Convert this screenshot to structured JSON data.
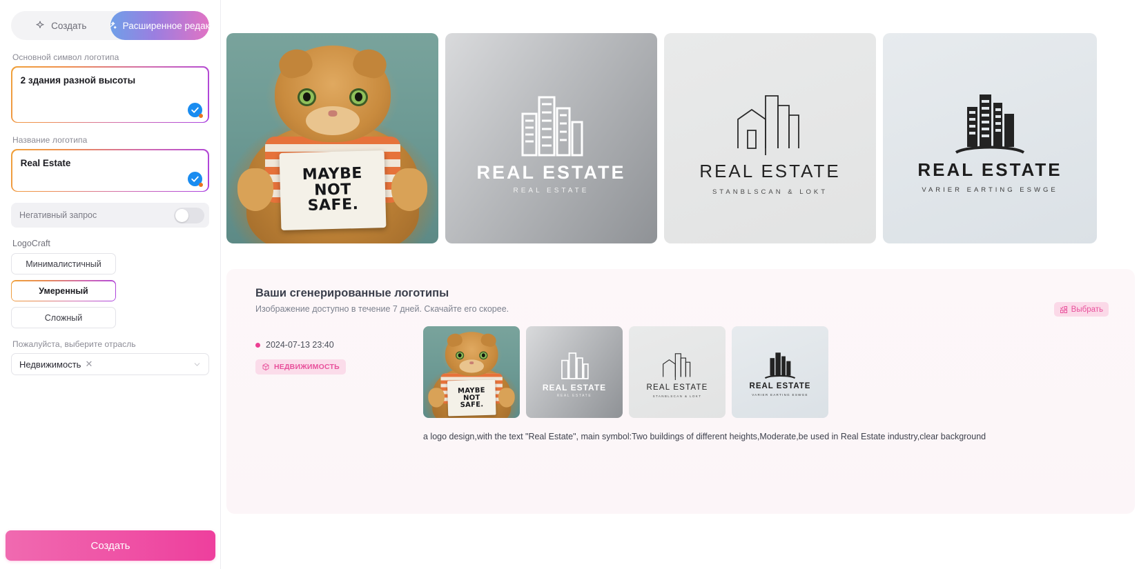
{
  "sidebar": {
    "tabs": [
      {
        "label": "Создать",
        "icon": "sparkle-icon",
        "active": false
      },
      {
        "label": "Расширенное редак...",
        "icon": "magic-wand-icon",
        "active": true
      }
    ],
    "symbol_field": {
      "label": "Основной символ логотипа",
      "value": "2 здания разной высоты",
      "validated": true
    },
    "name_field": {
      "label": "Название логотипа",
      "value": "Real Estate",
      "validated": true
    },
    "negative_prompt": {
      "label": "Негативный запрос",
      "enabled": false
    },
    "logocraft": {
      "label": "LogoCraft",
      "options": [
        {
          "label": "Минималистичный",
          "selected": false
        },
        {
          "label": "Умеренный",
          "selected": true
        },
        {
          "label": "Сложный",
          "selected": false
        }
      ]
    },
    "industry": {
      "label": "Пожалуйста, выберите отрасль",
      "value": "Недвижимость",
      "remove_icon": "close-x-icon",
      "caret_icon": "chevron-down-icon"
    },
    "create_button": "Создать"
  },
  "hero": {
    "cards": [
      {
        "kind": "photo",
        "sign_lines": [
          "MAYBE",
          "NOT",
          "SAFE."
        ]
      },
      {
        "kind": "logo",
        "title": "REAL ESTATE",
        "subtitle": "REAL ESTATE",
        "background": "#b9bbbe",
        "ink": "#ffffff"
      },
      {
        "kind": "logo",
        "title": "REAL ESTATE",
        "subtitle": "STANBLSCAN & LOKT",
        "background": "#e5e6e6",
        "ink": "#2a2a2a"
      },
      {
        "kind": "logo",
        "title": "REAL ESTATE",
        "subtitle": "VARIER EARTING ESWGE",
        "background": "#e1e6ea",
        "ink": "#232323"
      }
    ]
  },
  "results": {
    "title": "Ваши сгенерированные логотипы",
    "subtitle": "Изображение доступно в течение 7 дней. Скачайте его скорее.",
    "select_label": "Выбрать",
    "select_icon": "grid-select-icon",
    "date": "2024-07-13 23:40",
    "tag": {
      "label": "НЕДВИЖИМОСТЬ",
      "icon": "cube-icon"
    },
    "prompt": "a logo design,with the text \"Real Estate\", main symbol:Two buildings of different heights,Moderate,be used in Real Estate industry,clear background",
    "thumbnails": [
      {
        "kind": "photo",
        "sign_lines": [
          "MAYBE",
          "NOT",
          "SAFE."
        ]
      },
      {
        "kind": "logo",
        "title": "REAL ESTATE",
        "subtitle": "REAL ESTATE",
        "background": "#b9bbbe",
        "ink": "#ffffff"
      },
      {
        "kind": "logo",
        "title": "REAL ESTATE",
        "subtitle": "STANBLSCAN & LOKT",
        "background": "#e5e6e6",
        "ink": "#2a2a2a"
      },
      {
        "kind": "logo",
        "title": "REAL ESTATE",
        "subtitle": "VARIER EARTING ESWGE",
        "background": "#e1e6ea",
        "ink": "#232323"
      }
    ]
  },
  "colors": {
    "accent_pink": "#ee3f9d",
    "gradient_border": "#f0a13a",
    "tab_gradient_start": "#6f9fe8",
    "tab_gradient_end": "#e173c4",
    "check_blue": "#1a8cf0"
  }
}
